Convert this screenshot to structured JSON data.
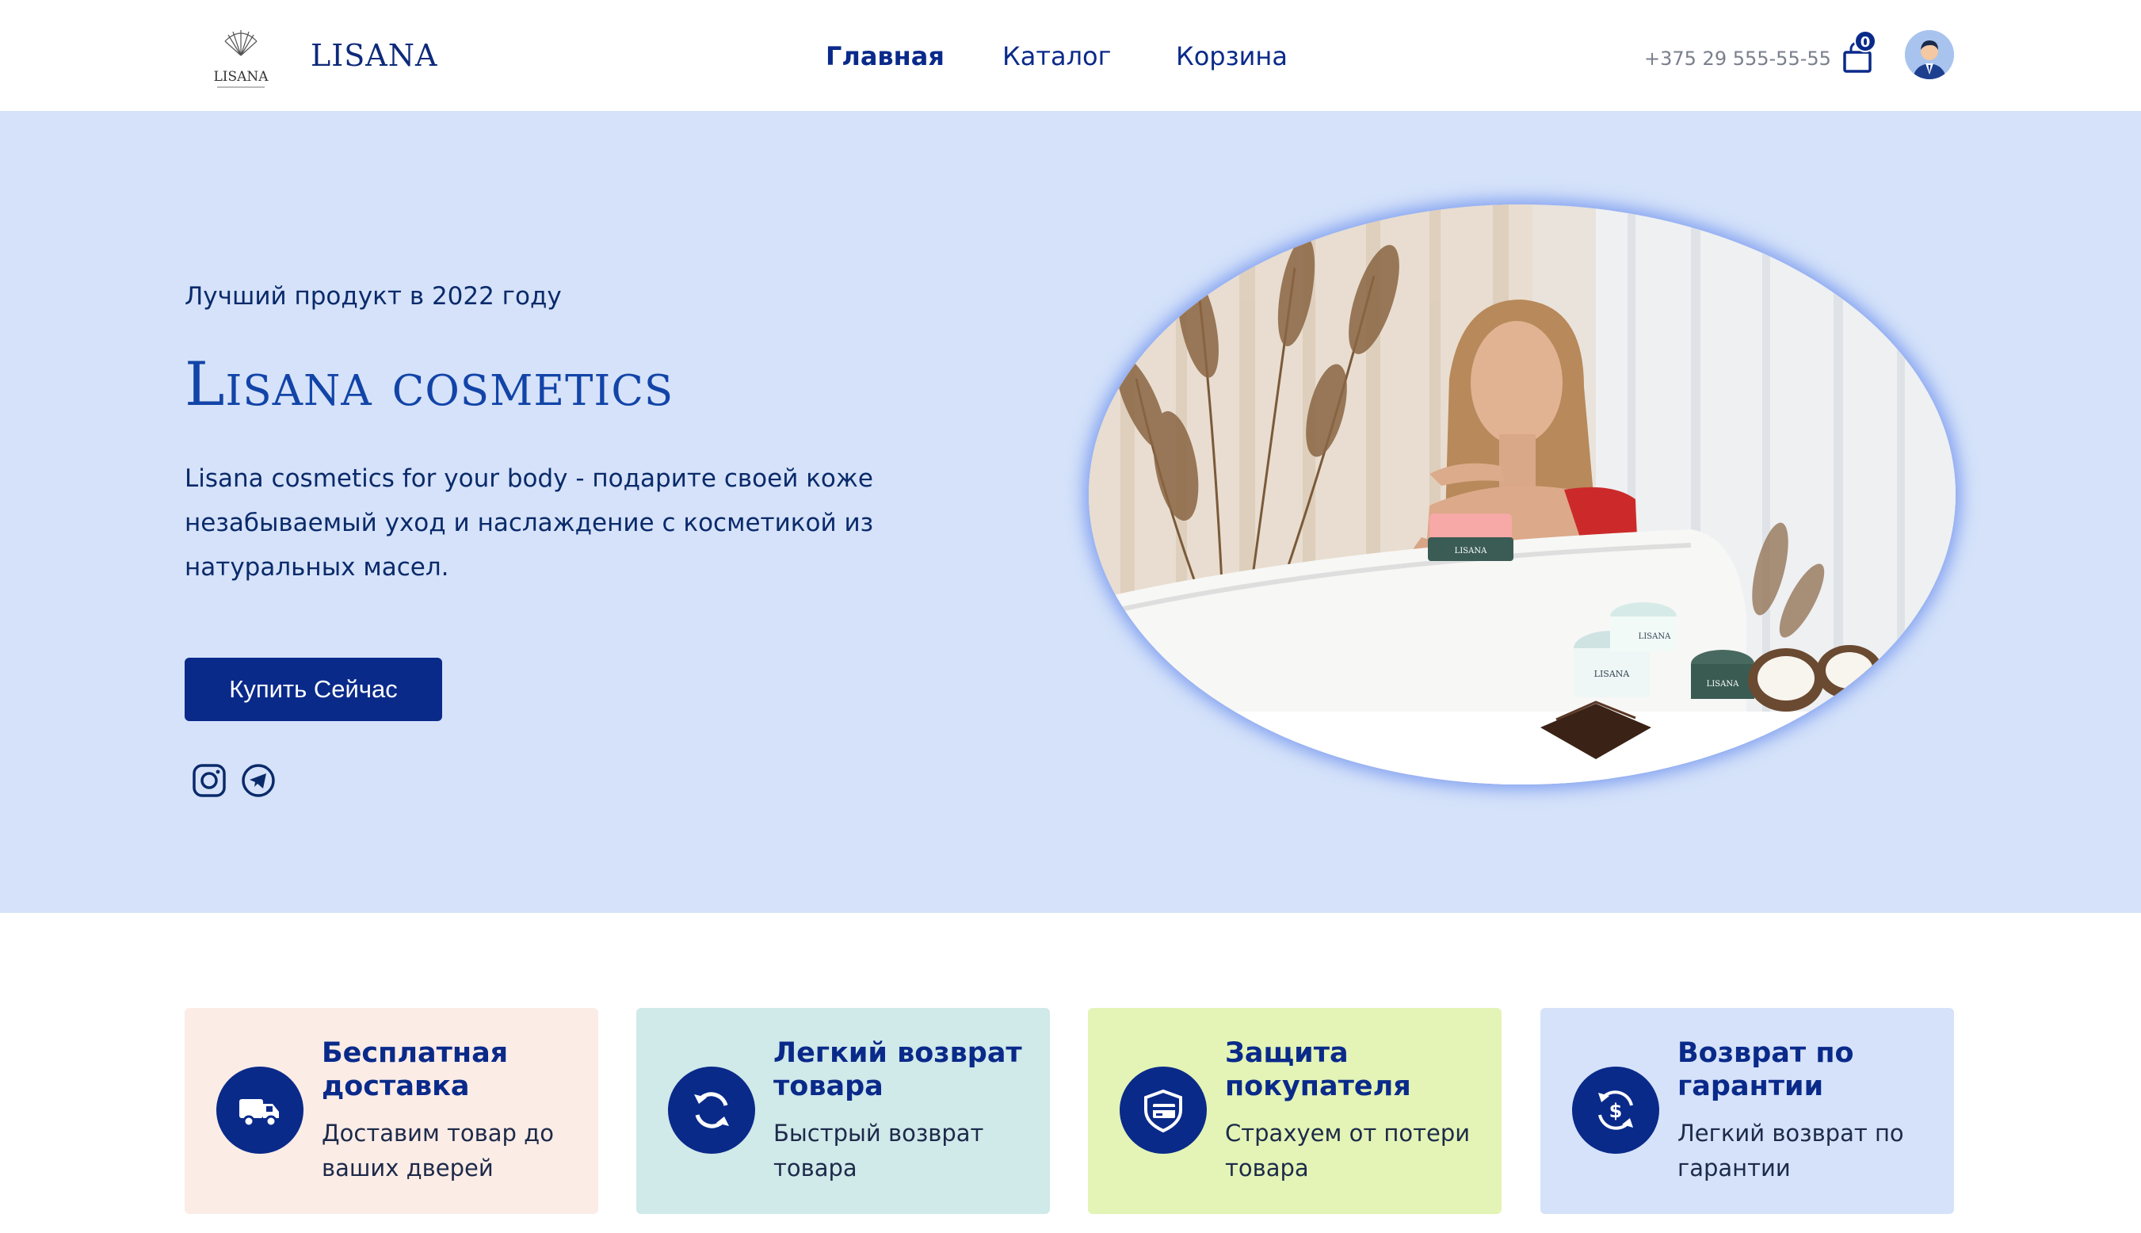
{
  "header": {
    "logo_text": "LISANA",
    "brand": "LISANA",
    "nav": [
      {
        "label": "Главная"
      },
      {
        "label": "Каталог"
      },
      {
        "label": "Корзина"
      }
    ],
    "phone": "+375 29 555-55-55",
    "cart_count": "0"
  },
  "hero": {
    "kicker": "Лучший продукт в 2022 году",
    "title": "Lisana cosmetics",
    "description": "Lisana cosmetics for your body - подарите своей коже незабываемый уход и наслаждение с косметикой из натуральных масел.",
    "cta": "Купить Сейчас",
    "product_labels": [
      "LISANA",
      "LISANA",
      "LISANA",
      "LISANA"
    ]
  },
  "features": [
    {
      "title": "Бесплатная доставка",
      "text": "Доставим товар до ваших дверей",
      "bg": "#fbece6",
      "icon": "truck-icon"
    },
    {
      "title": "Легкий возврат товара",
      "text": "Быстрый возврат товара",
      "bg": "#d0e9e9",
      "icon": "refresh-icon"
    },
    {
      "title": "Защита покупателя",
      "text": "Страхуем от потери товара",
      "bg": "#e3f4b6",
      "icon": "shield-card-icon"
    },
    {
      "title": "Возврат по гарантии",
      "text": "Легкий возврат по гарантии",
      "bg": "#d5e2f9",
      "icon": "money-back-icon"
    }
  ],
  "colors": {
    "primary": "#0a2a8a",
    "hero_bg": "#d5e2f9",
    "title": "#1244a8"
  }
}
